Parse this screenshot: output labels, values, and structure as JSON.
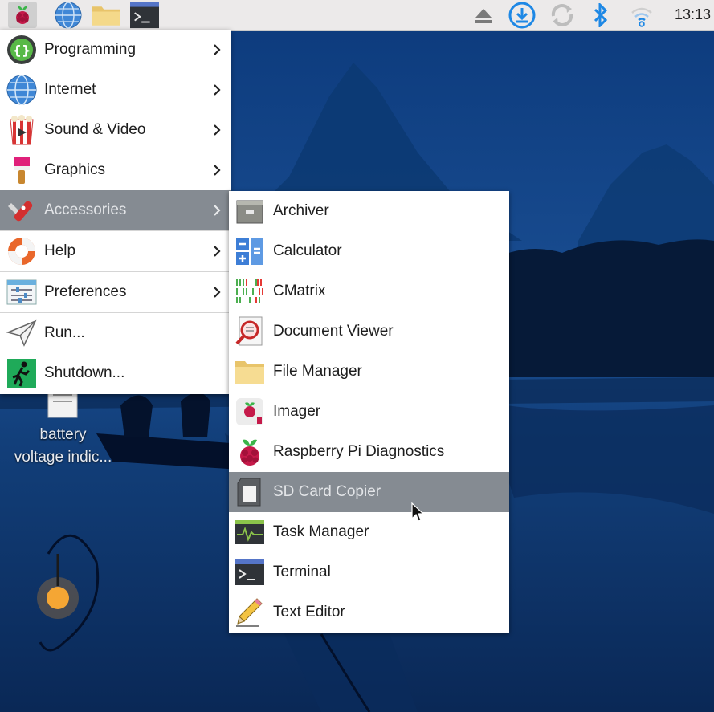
{
  "taskbar": {
    "clock": "13:13",
    "launchers": [
      "raspberry-menu-icon",
      "web-browser-icon",
      "file-manager-icon",
      "terminal-icon"
    ],
    "tray": [
      "eject-icon",
      "updates-icon",
      "sync-icon",
      "bluetooth-icon",
      "wifi-icon"
    ]
  },
  "main_menu": {
    "items": [
      {
        "label": "Programming",
        "icon": "programming-icon",
        "submenu": true
      },
      {
        "label": "Internet",
        "icon": "internet-icon",
        "submenu": true
      },
      {
        "label": "Sound & Video",
        "icon": "sound-video-icon",
        "submenu": true
      },
      {
        "label": "Graphics",
        "icon": "graphics-icon",
        "submenu": true
      },
      {
        "label": "Accessories",
        "icon": "accessories-icon",
        "submenu": true,
        "highlighted": true
      },
      {
        "label": "Help",
        "icon": "help-icon",
        "submenu": true
      },
      {
        "label": "Preferences",
        "icon": "preferences-icon",
        "submenu": true
      },
      {
        "label": "Run...",
        "icon": "run-icon",
        "submenu": false
      },
      {
        "label": "Shutdown...",
        "icon": "shutdown-icon",
        "submenu": false
      }
    ]
  },
  "accessories_menu": {
    "items": [
      {
        "label": "Archiver",
        "icon": "archiver-icon"
      },
      {
        "label": "Calculator",
        "icon": "calculator-icon"
      },
      {
        "label": "CMatrix",
        "icon": "cmatrix-icon"
      },
      {
        "label": "Document Viewer",
        "icon": "document-viewer-icon"
      },
      {
        "label": "File Manager",
        "icon": "folder-icon"
      },
      {
        "label": "Imager",
        "icon": "imager-icon"
      },
      {
        "label": "Raspberry Pi Diagnostics",
        "icon": "raspberry-icon"
      },
      {
        "label": "SD Card Copier",
        "icon": "sd-card-icon",
        "highlighted": true
      },
      {
        "label": "Task Manager",
        "icon": "task-manager-icon"
      },
      {
        "label": "Terminal",
        "icon": "terminal-icon"
      },
      {
        "label": "Text Editor",
        "icon": "text-editor-icon"
      }
    ]
  },
  "desktop": {
    "icon_label_line1": "battery",
    "icon_label_line2": "voltage indic..."
  },
  "colors": {
    "highlight": "#858b92",
    "taskbar": "#eceaea",
    "accent_blue": "#1e88e5"
  }
}
